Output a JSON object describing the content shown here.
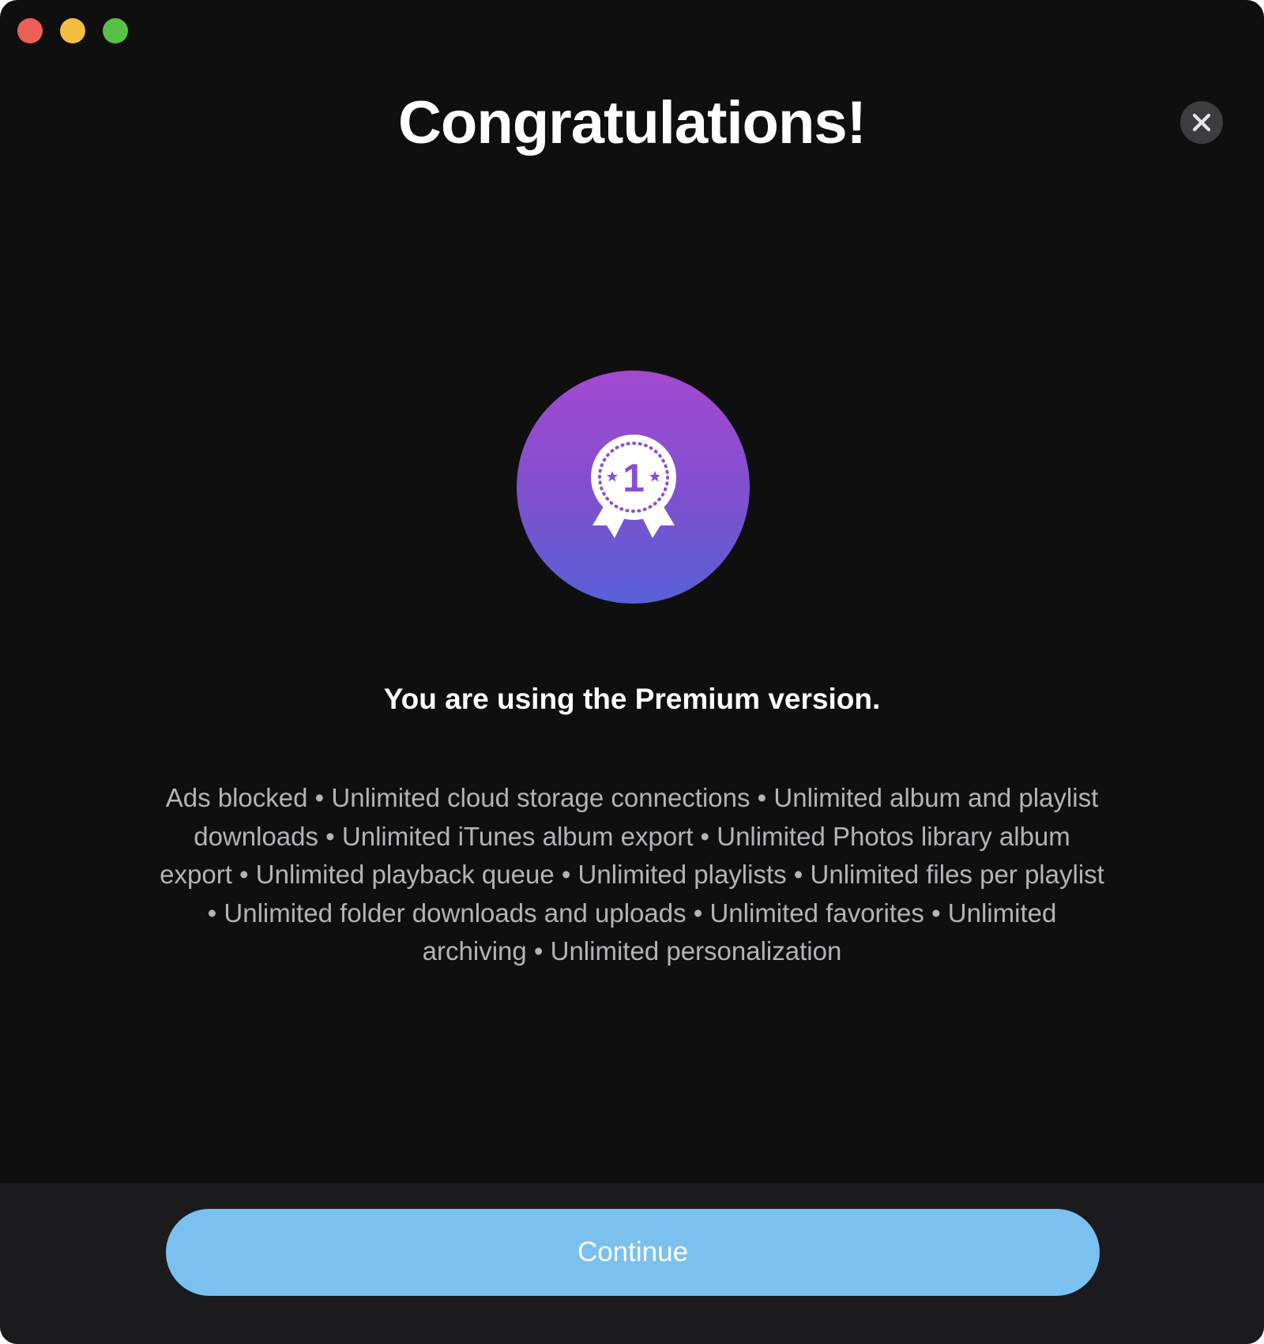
{
  "window": {
    "controls": [
      "close",
      "minimize",
      "zoom"
    ]
  },
  "dialog": {
    "title": "Congratulations!",
    "close_icon": "close-icon",
    "badge_icon": "award-ribbon-icon",
    "badge_number": "1",
    "subtitle": "You are using the Premium version.",
    "features_text": "Ads blocked • Unlimited cloud storage connections • Unlimited album and playlist downloads • Unlimited iTunes album export • Unlimited Photos library album export • Unlimited playback queue • Unlimited playlists • Unlimited files per playlist • Unlimited folder downloads and uploads • Unlimited favorites • Unlimited archiving • Unlimited personalization",
    "continue_label": "Continue"
  },
  "colors": {
    "background": "#0f0f10",
    "footer": "#1b1b1d",
    "accent_button": "#7ac1ef",
    "badge_gradient_top": "#a349cf",
    "badge_gradient_bottom": "#5761d6"
  }
}
